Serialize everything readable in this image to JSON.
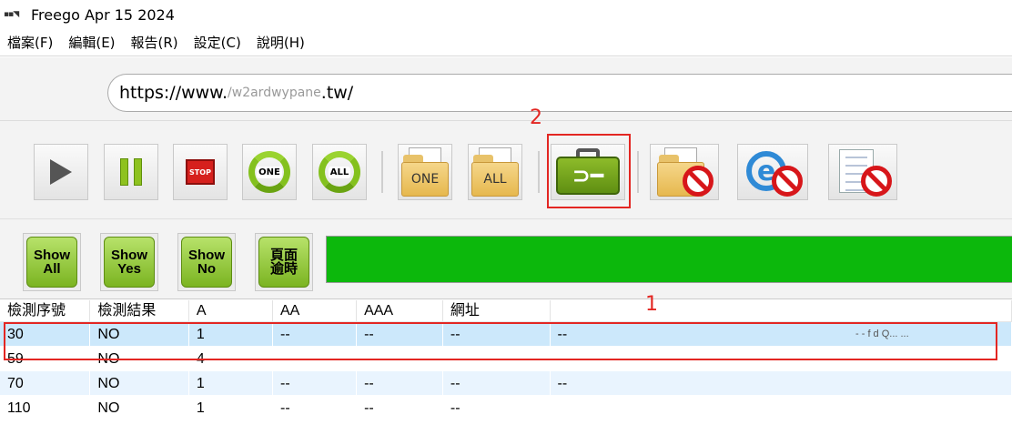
{
  "window": {
    "title": "Freego Apr 15 2024",
    "app_icon": "freego-app-icon"
  },
  "menu": [
    "檔案(F)",
    "編輯(E)",
    "報告(R)",
    "設定(C)",
    "說明(H)"
  ],
  "url": {
    "prefix": "https://www.",
    "obscured": "/w2ardwypane",
    "suffix": ".tw/"
  },
  "toolbar": {
    "buttons": [
      {
        "name": "play",
        "icon": "play-icon"
      },
      {
        "name": "pause",
        "icon": "pause-icon"
      },
      {
        "name": "stop",
        "icon": "stop-icon",
        "label": "STOP"
      },
      {
        "name": "recheck-one",
        "icon": "refresh-icon",
        "label": "ONE"
      },
      {
        "name": "recheck-all",
        "icon": "refresh-icon",
        "label": "ALL"
      },
      {
        "name": "folder-one",
        "icon": "folder-icon",
        "label": "ONE"
      },
      {
        "name": "folder-all",
        "icon": "folder-icon",
        "label": "ALL"
      },
      {
        "name": "settings-toolbox",
        "icon": "toolbox-wrench-icon"
      },
      {
        "name": "folder-block",
        "icon": "folder-no-icon"
      },
      {
        "name": "ie-block",
        "icon": "ie-no-icon"
      },
      {
        "name": "document-block",
        "icon": "document-no-icon"
      }
    ]
  },
  "annotations": {
    "box1": "1",
    "box2": "2"
  },
  "filters": [
    {
      "line1": "Show",
      "line2": "All"
    },
    {
      "line1": "Show",
      "line2": "Yes"
    },
    {
      "line1": "Show",
      "line2": "No"
    },
    {
      "line1": "頁面",
      "line2": "逾時"
    }
  ],
  "progress": {
    "percent": 100,
    "color": "#0cb80c"
  },
  "table": {
    "columns": [
      "檢測序號",
      "檢測結果",
      "A",
      "AA",
      "AAA",
      "網址"
    ],
    "rows": [
      {
        "cells": [
          "30",
          "NO",
          "1",
          "--",
          "--",
          "--",
          "--"
        ],
        "extra": "- - f d Q... ..."
      },
      {
        "cells": [
          "59",
          "NO",
          "4",
          "--",
          "--",
          "--",
          "--"
        ],
        "extra": ""
      },
      {
        "cells": [
          "70",
          "NO",
          "1",
          "--",
          "--",
          "--",
          "--"
        ],
        "extra": ""
      },
      {
        "cells": [
          "110",
          "NO",
          "1",
          "--",
          "--",
          "--",
          ""
        ],
        "extra": ""
      }
    ]
  }
}
